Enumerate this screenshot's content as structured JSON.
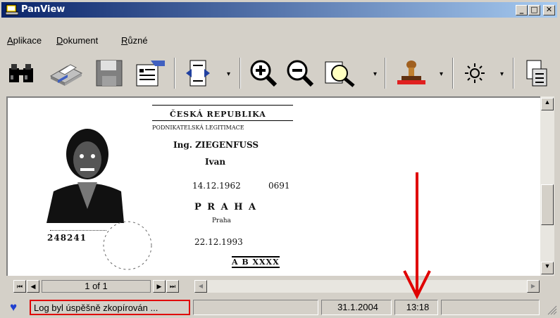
{
  "window": {
    "title": "PanView"
  },
  "menu": [
    {
      "label": "Aplikace",
      "accel": "A",
      "rest": "plikace"
    },
    {
      "label": "Dokument",
      "accel": "D",
      "rest": "okument"
    },
    {
      "label": "Různé",
      "accel": "R",
      "rest": "ůzné"
    }
  ],
  "toolbar": [
    {
      "name": "find-icon"
    },
    {
      "name": "print-icon"
    },
    {
      "name": "save-icon"
    },
    {
      "name": "properties-icon"
    },
    {
      "name": "page-flip-icon"
    },
    {
      "name": "zoom-in-icon"
    },
    {
      "name": "zoom-out-icon"
    },
    {
      "name": "zoom-area-icon"
    },
    {
      "name": "stamp-icon"
    },
    {
      "name": "brightness-icon"
    },
    {
      "name": "export-icon"
    }
  ],
  "document": {
    "header": "ČESKÁ REPUBLIKA",
    "subheader": "PODNIKATELSKÁ LEGITIMACE",
    "name1": "Ing. ZIEGENFUSS",
    "name2": "Ivan",
    "date1": "14.12.1962",
    "code1": "0691",
    "city": "P R A H A",
    "city_sub": "Praha",
    "date2": "22.12.1993",
    "number": "248241",
    "serial": "A B XXXX"
  },
  "navigation": {
    "page_indicator": "1 of 1"
  },
  "status": {
    "message": "Log byl úspěšně zkopírován ...",
    "date": "31.1.2004",
    "time": "13:18"
  },
  "annotation": {
    "highlight_color": "#e00000",
    "arrow_color": "#e00000"
  }
}
